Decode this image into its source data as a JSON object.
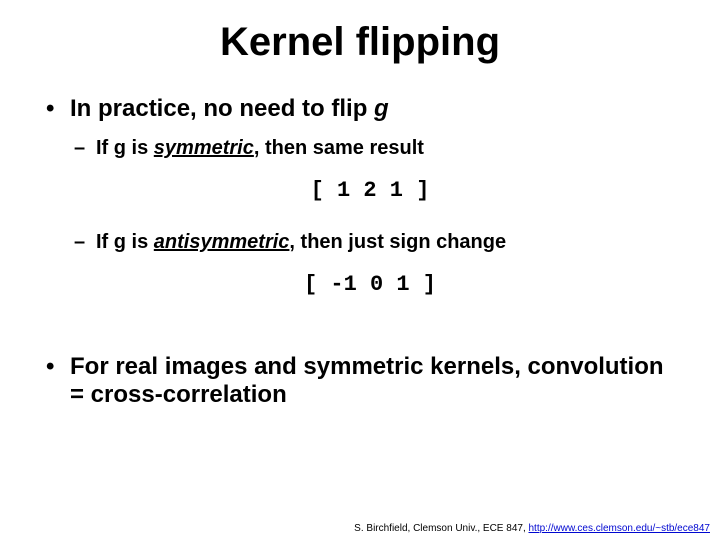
{
  "title": "Kernel flipping",
  "bullet1": {
    "prefix": "In practice, no need to flip ",
    "var": "g"
  },
  "sub1": {
    "prefix": "If g is ",
    "kw": "symmetric",
    "suffix": ", then same result"
  },
  "code1": "[ 1 2 1 ]",
  "sub2": {
    "prefix": "If g is ",
    "kw": "antisymmetric",
    "suffix": ", then just sign change"
  },
  "code2": "[ -1 0 1 ]",
  "bullet2": "For real images and symmetric kernels, convolution = cross-correlation",
  "footer": {
    "text": "S. Birchfield, Clemson Univ., ECE 847, ",
    "link": "http://www.ces.clemson.edu/~stb/ece847"
  }
}
